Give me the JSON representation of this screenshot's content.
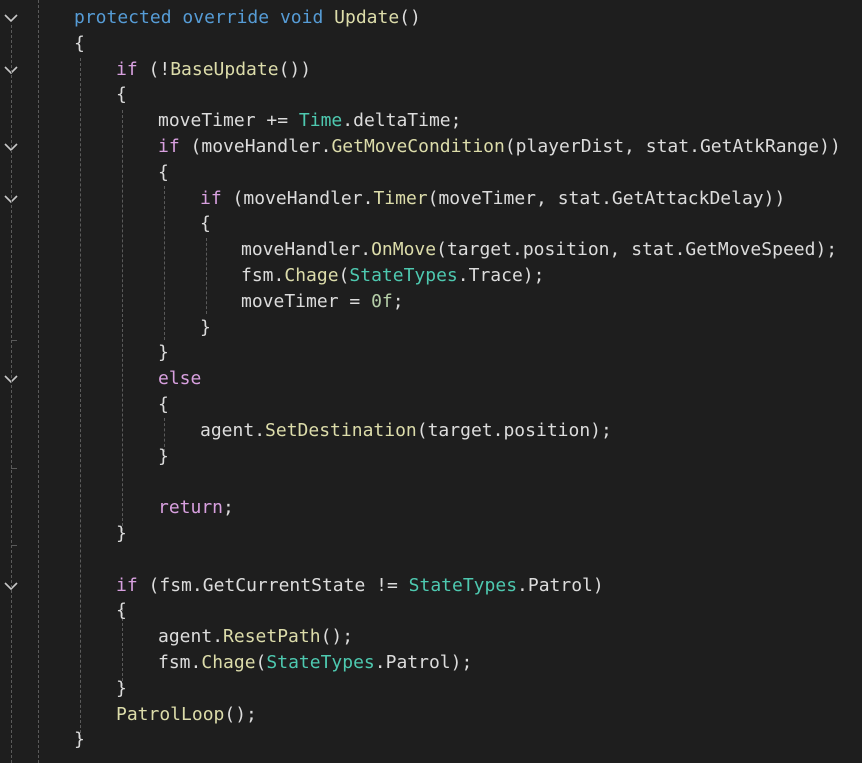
{
  "editor": {
    "background": "#1e1e1e",
    "colors": {
      "keyword": "#569cd6",
      "control": "#d8a0df",
      "method": "#dcdcaa",
      "type": "#4ec9b0",
      "number": "#b5cea8",
      "text": "#dcdcdc"
    },
    "fold_icon": "chevron-down-icon",
    "lines": [
      {
        "tokens": [
          [
            "kw",
            "protected"
          ],
          [
            "op",
            " "
          ],
          [
            "kw",
            "override"
          ],
          [
            "op",
            " "
          ],
          [
            "kw",
            "void"
          ],
          [
            "op",
            " "
          ],
          [
            "fn",
            "Update"
          ],
          [
            "op",
            "()"
          ]
        ]
      },
      {
        "tokens": [
          [
            "op",
            "{"
          ]
        ]
      },
      {
        "tokens": [
          [
            "ctl",
            "if"
          ],
          [
            "op",
            " (!"
          ],
          [
            "fn",
            "BaseUpdate"
          ],
          [
            "op",
            "())"
          ]
        ]
      },
      {
        "tokens": [
          [
            "op",
            "{"
          ]
        ]
      },
      {
        "tokens": [
          [
            "id",
            "moveTimer"
          ],
          [
            "op",
            " += "
          ],
          [
            "type",
            "Time"
          ],
          [
            "op",
            "."
          ],
          [
            "id",
            "deltaTime"
          ],
          [
            "op",
            ";"
          ]
        ]
      },
      {
        "tokens": [
          [
            "ctl",
            "if"
          ],
          [
            "op",
            " ("
          ],
          [
            "id",
            "moveHandler"
          ],
          [
            "op",
            "."
          ],
          [
            "fn",
            "GetMoveCondition"
          ],
          [
            "op",
            "("
          ],
          [
            "id",
            "playerDist"
          ],
          [
            "op",
            ", "
          ],
          [
            "id",
            "stat"
          ],
          [
            "op",
            "."
          ],
          [
            "id",
            "GetAtkRange"
          ],
          [
            "op",
            "))"
          ]
        ]
      },
      {
        "tokens": [
          [
            "op",
            "{"
          ]
        ]
      },
      {
        "tokens": [
          [
            "ctl",
            "if"
          ],
          [
            "op",
            " ("
          ],
          [
            "id",
            "moveHandler"
          ],
          [
            "op",
            "."
          ],
          [
            "fn",
            "Timer"
          ],
          [
            "op",
            "("
          ],
          [
            "id",
            "moveTimer"
          ],
          [
            "op",
            ", "
          ],
          [
            "id",
            "stat"
          ],
          [
            "op",
            "."
          ],
          [
            "id",
            "GetAttackDelay"
          ],
          [
            "op",
            "))"
          ]
        ]
      },
      {
        "tokens": [
          [
            "op",
            "{"
          ]
        ]
      },
      {
        "tokens": [
          [
            "id",
            "moveHandler"
          ],
          [
            "op",
            "."
          ],
          [
            "fn",
            "OnMove"
          ],
          [
            "op",
            "("
          ],
          [
            "id",
            "target"
          ],
          [
            "op",
            "."
          ],
          [
            "id",
            "position"
          ],
          [
            "op",
            ", "
          ],
          [
            "id",
            "stat"
          ],
          [
            "op",
            "."
          ],
          [
            "id",
            "GetMoveSpeed"
          ],
          [
            "op",
            ");"
          ]
        ]
      },
      {
        "tokens": [
          [
            "id",
            "fsm"
          ],
          [
            "op",
            "."
          ],
          [
            "fn",
            "Chage"
          ],
          [
            "op",
            "("
          ],
          [
            "type",
            "StateTypes"
          ],
          [
            "op",
            "."
          ],
          [
            "id",
            "Trace"
          ],
          [
            "op",
            ");"
          ]
        ]
      },
      {
        "tokens": [
          [
            "id",
            "moveTimer"
          ],
          [
            "op",
            " = "
          ],
          [
            "num",
            "0f"
          ],
          [
            "op",
            ";"
          ]
        ]
      },
      {
        "tokens": [
          [
            "op",
            "}"
          ]
        ]
      },
      {
        "tokens": [
          [
            "op",
            "}"
          ]
        ]
      },
      {
        "tokens": [
          [
            "ctl",
            "else"
          ]
        ]
      },
      {
        "tokens": [
          [
            "op",
            "{"
          ]
        ]
      },
      {
        "tokens": [
          [
            "id",
            "agent"
          ],
          [
            "op",
            "."
          ],
          [
            "fn",
            "SetDestination"
          ],
          [
            "op",
            "("
          ],
          [
            "id",
            "target"
          ],
          [
            "op",
            "."
          ],
          [
            "id",
            "position"
          ],
          [
            "op",
            ");"
          ]
        ]
      },
      {
        "tokens": [
          [
            "op",
            "}"
          ]
        ]
      },
      {
        "tokens": []
      },
      {
        "tokens": [
          [
            "ctl",
            "return"
          ],
          [
            "op",
            ";"
          ]
        ]
      },
      {
        "tokens": [
          [
            "op",
            "}"
          ]
        ]
      },
      {
        "tokens": []
      },
      {
        "tokens": [
          [
            "ctl",
            "if"
          ],
          [
            "op",
            " ("
          ],
          [
            "id",
            "fsm"
          ],
          [
            "op",
            "."
          ],
          [
            "id",
            "GetCurrentState"
          ],
          [
            "op",
            " != "
          ],
          [
            "type",
            "StateTypes"
          ],
          [
            "op",
            "."
          ],
          [
            "id",
            "Patrol"
          ],
          [
            "op",
            ")"
          ]
        ]
      },
      {
        "tokens": [
          [
            "op",
            "{"
          ]
        ]
      },
      {
        "tokens": [
          [
            "id",
            "agent"
          ],
          [
            "op",
            "."
          ],
          [
            "fn",
            "ResetPath"
          ],
          [
            "op",
            "();"
          ]
        ]
      },
      {
        "tokens": [
          [
            "id",
            "fsm"
          ],
          [
            "op",
            "."
          ],
          [
            "fn",
            "Chage"
          ],
          [
            "op",
            "("
          ],
          [
            "type",
            "StateTypes"
          ],
          [
            "op",
            "."
          ],
          [
            "id",
            "Patrol"
          ],
          [
            "op",
            ");"
          ]
        ]
      },
      {
        "tokens": [
          [
            "op",
            "}"
          ]
        ]
      },
      {
        "tokens": [
          [
            "fn",
            "PatrolLoop"
          ],
          [
            "op",
            "();"
          ]
        ]
      },
      {
        "tokens": [
          [
            "op",
            "}"
          ]
        ]
      }
    ]
  }
}
